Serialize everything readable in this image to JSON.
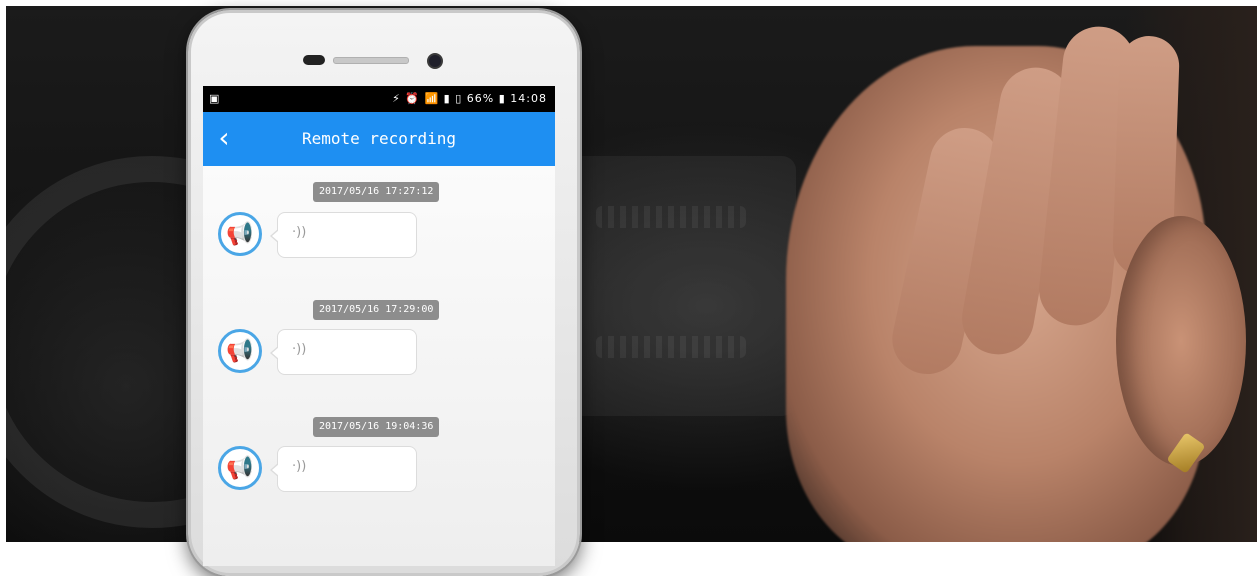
{
  "status_bar": {
    "left_icon": "sim-icon",
    "right_icons_text": "⚡ ⏰ 📶 ▮ ▯ 66% ▮",
    "time": "14:08"
  },
  "app_bar": {
    "back_icon": "chevron-left-icon",
    "title": "Remote recording"
  },
  "messages": [
    {
      "timestamp": "2017/05/16 17:27:12",
      "voice_icon": "voice-wave-icon"
    },
    {
      "timestamp": "2017/05/16 17:29:00",
      "voice_icon": "voice-wave-icon"
    },
    {
      "timestamp": "2017/05/16 19:04:36",
      "voice_icon": "voice-wave-icon"
    }
  ],
  "colors": {
    "app_bar": "#1e8ff2",
    "avatar_ring": "#4aa6e6",
    "timestamp_bg": "#8d8d8d"
  }
}
